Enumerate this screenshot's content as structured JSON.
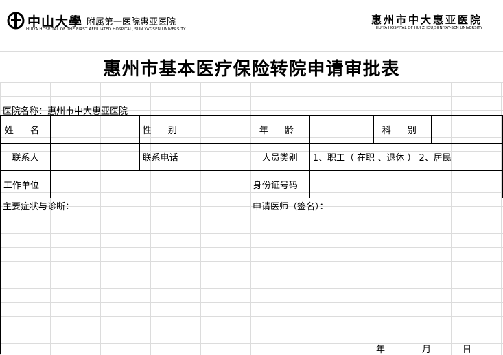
{
  "header": {
    "left_logo_name": "中山大學",
    "left_logo_sub": "附属第一医院惠亚医院",
    "left_logo_en": "HUIYA HOSPITAL OF THE FIRST AFFILIATED HOSPITAL, SUN YAT-SEN UNIVERSITY",
    "right_logo_name": "惠州市中大惠亚医院",
    "right_logo_en": "HUIYA HOSPITAL OF HUI ZHOU,SUN YAT-SEN UNIVERSITY"
  },
  "title": "惠州市基本医疗保险转院申请审批表",
  "hospital_line": "医院名称：惠州市中大惠亚医院",
  "form": {
    "name_label": "姓 名",
    "gender_label": "性 别",
    "age_label": "年 龄",
    "dept_label": "科 别",
    "contact_label": "联系人",
    "phone_label": "联系电话",
    "category_label": "人员类别",
    "category_options": "1、职工（ 在职 、退休 ） 2、居民",
    "work_label": "工作单位",
    "id_label": "身份证号码",
    "symptoms_label": "主要症状与诊断：",
    "doctor_label": "申请医师（签名）：",
    "date_year": "年",
    "date_month": "月",
    "date_day": "日"
  },
  "icons": [
    "sysu-emblem-icon"
  ]
}
